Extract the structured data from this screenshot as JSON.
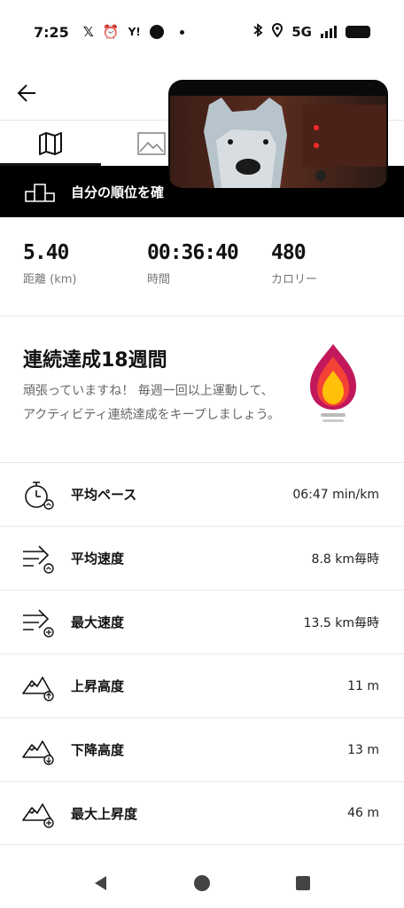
{
  "status_bar": {
    "time": "7:25",
    "icons": [
      "x-icon",
      "alarm-icon",
      "yahoo-icon",
      "circle-icon",
      "dot-icon"
    ],
    "yahoo_text": "Y!",
    "network": "5G"
  },
  "banner": {
    "label": "自分の順位を確"
  },
  "stats": [
    {
      "value": "5.40",
      "label": "距離 (km)"
    },
    {
      "value": "00:36:40",
      "label": "時間"
    },
    {
      "value": "480",
      "label": "カロリー"
    }
  ],
  "streak": {
    "title": "連続達成18週間",
    "description": "頑張っていますね！ 毎週一回以上運動して、アクティビティ連続達成をキープしましょう。"
  },
  "metrics": [
    {
      "icon": "stopwatch-icon",
      "label": "平均ペース",
      "value": "06:47 min/km"
    },
    {
      "icon": "speed-avg-icon",
      "label": "平均速度",
      "value": "8.8 km毎時"
    },
    {
      "icon": "speed-max-icon",
      "label": "最大速度",
      "value": "13.5 km毎時"
    },
    {
      "icon": "elevation-gain-icon",
      "label": "上昇高度",
      "value": "11 m"
    },
    {
      "icon": "elevation-loss-icon",
      "label": "下降高度",
      "value": "13 m"
    },
    {
      "icon": "elevation-max-icon",
      "label": "最大上昇度",
      "value": "46 m"
    }
  ],
  "colors": {
    "accent": "#000000",
    "flame_outer": "#c2185b",
    "flame_mid": "#f44336",
    "flame_inner": "#ffc107"
  }
}
